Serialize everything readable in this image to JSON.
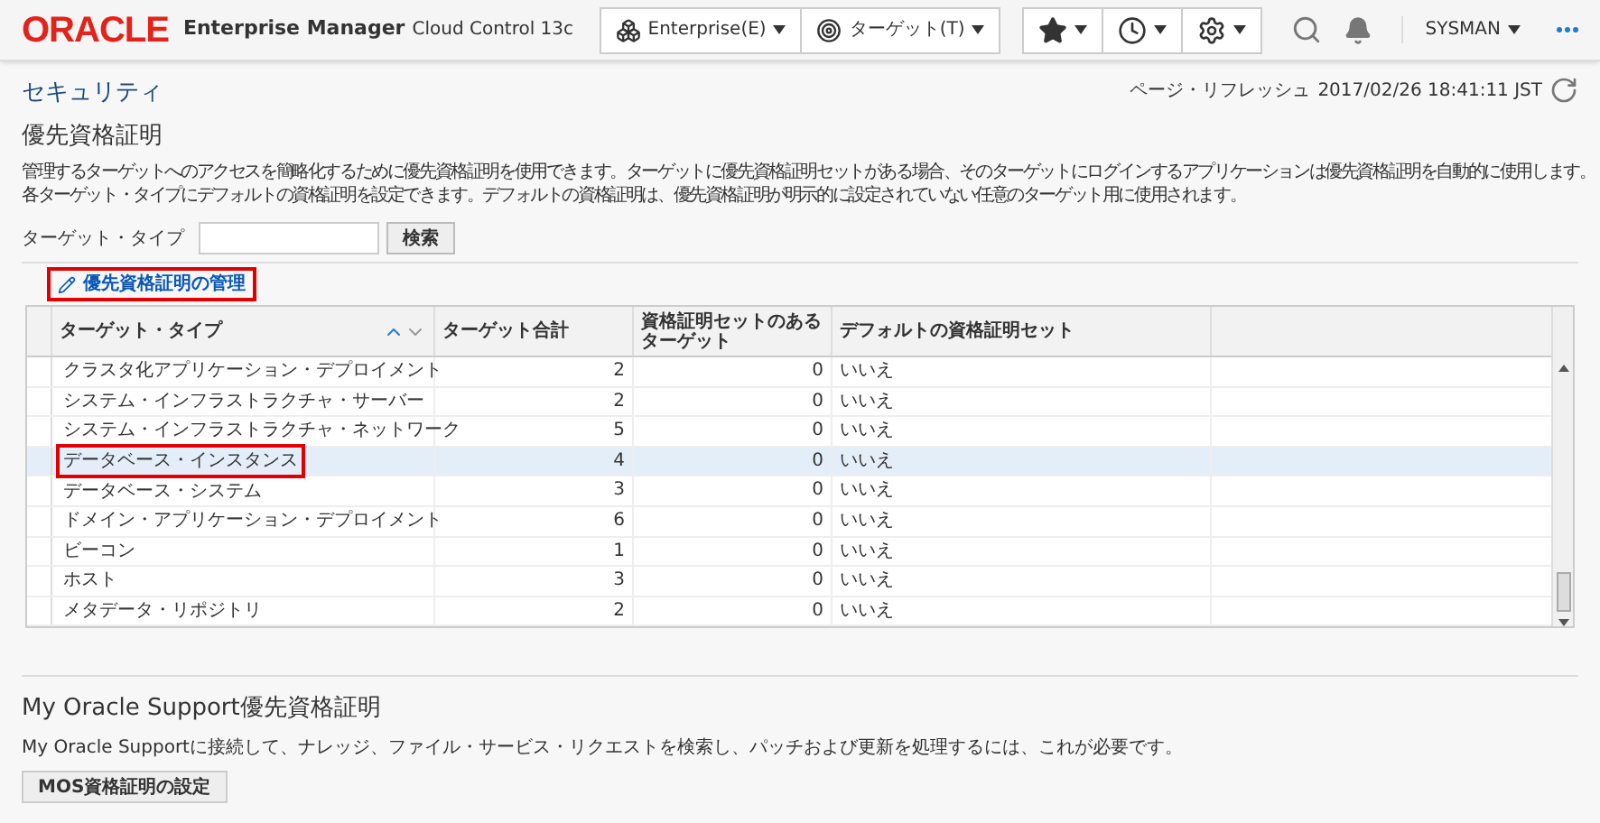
{
  "header": {
    "logo": "ORACLE",
    "product": "Enterprise Manager",
    "edition": "Cloud Control 13c",
    "menus": [
      {
        "label": "Enterprise(E)",
        "kind": "enterprise"
      },
      {
        "label": "ターゲット(T)",
        "kind": "target"
      }
    ],
    "user": "SYSMAN"
  },
  "breadcrumb": "セキュリティ",
  "refresh": {
    "label": "ページ・リフレッシュ",
    "time": "2017/02/26 18:41:11 JST"
  },
  "title": "優先資格証明",
  "description": [
    "管理するターゲットへのアクセスを簡略化するために優先資格証明を使用できます。ターゲットに優先資格証明セットがある場合、そのターゲットにログインするアプリケーションは優先資格証明を自動的に使用します。",
    "各ターゲット・タイプにデフォルトの資格証明を設定できます。デフォルトの資格証明は、優先資格証明が明示的に設定されていない任意のターゲット用に使用されます。"
  ],
  "search": {
    "label": "ターゲット・タイプ",
    "button": "検索"
  },
  "manage_link": {
    "label": "優先資格証明の管理",
    "highlighted": true
  },
  "table": {
    "columns": [
      "ターゲット・タイプ",
      "ターゲット合計",
      "資格証明セットのあるターゲット",
      "デフォルトの資格証明セット"
    ],
    "rows": [
      {
        "type": "クラスタ化アプリケーション・デプロイメント",
        "total": "2",
        "with_set": "0",
        "default": "いいえ",
        "selected": false,
        "highlighted": false
      },
      {
        "type": "システム・インフラストラクチャ・サーバー",
        "total": "2",
        "with_set": "0",
        "default": "いいえ",
        "selected": false,
        "highlighted": false
      },
      {
        "type": "システム・インフラストラクチャ・ネットワーク",
        "total": "5",
        "with_set": "0",
        "default": "いいえ",
        "selected": false,
        "highlighted": false
      },
      {
        "type": "データベース・インスタンス",
        "total": "4",
        "with_set": "0",
        "default": "いいえ",
        "selected": true,
        "highlighted": true
      },
      {
        "type": "データベース・システム",
        "total": "3",
        "with_set": "0",
        "default": "いいえ",
        "selected": false,
        "highlighted": false
      },
      {
        "type": "ドメイン・アプリケーション・デプロイメント",
        "total": "6",
        "with_set": "0",
        "default": "いいえ",
        "selected": false,
        "highlighted": false
      },
      {
        "type": "ビーコン",
        "total": "1",
        "with_set": "0",
        "default": "いいえ",
        "selected": false,
        "highlighted": false
      },
      {
        "type": "ホスト",
        "total": "3",
        "with_set": "0",
        "default": "いいえ",
        "selected": false,
        "highlighted": false
      },
      {
        "type": "メタデータ・リポジトリ",
        "total": "2",
        "with_set": "0",
        "default": "いいえ",
        "selected": false,
        "highlighted": false
      }
    ]
  },
  "mos": {
    "title": "My Oracle Support優先資格証明",
    "description": "My Oracle Supportに接続して、ナレッジ、ファイル・サービス・リクエストを検索し、パッチおよび更新を処理するには、これが必要です。",
    "button": "MOS資格証明の設定"
  }
}
